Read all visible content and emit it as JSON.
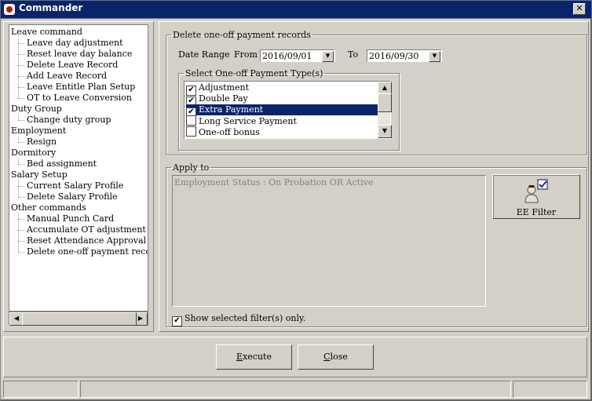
{
  "window": {
    "title": "Commander",
    "close_glyph": "✕",
    "app_icon": "commander-app-icon"
  },
  "tree": {
    "items": [
      {
        "label": "Leave command",
        "level": 0
      },
      {
        "label": "Leave day adjustment",
        "level": 1
      },
      {
        "label": "Reset leave day balance",
        "level": 1
      },
      {
        "label": "Delete Leave Record",
        "level": 1
      },
      {
        "label": "Add Leave Record",
        "level": 1
      },
      {
        "label": "Leave Entitle Plan Setup",
        "level": 1
      },
      {
        "label": "OT to Leave Conversion",
        "level": 1
      },
      {
        "label": "Duty Group",
        "level": 0
      },
      {
        "label": "Change duty group",
        "level": 1
      },
      {
        "label": "Employment",
        "level": 0
      },
      {
        "label": "Resign",
        "level": 1
      },
      {
        "label": "Dormitory",
        "level": 0
      },
      {
        "label": "Bed assignment",
        "level": 1
      },
      {
        "label": "Salary Setup",
        "level": 0
      },
      {
        "label": "Current Salary Profile",
        "level": 1
      },
      {
        "label": "Delete Salary Profile",
        "level": 1
      },
      {
        "label": "Other commands",
        "level": 0
      },
      {
        "label": "Manual Punch Card",
        "level": 1
      },
      {
        "label": "Accumulate OT adjustment",
        "level": 1
      },
      {
        "label": "Reset Attendance Approval Leve",
        "level": 1
      },
      {
        "label": "Delete one-off payment records",
        "level": 1
      }
    ],
    "scroll_left": "◀",
    "scroll_right": "▶"
  },
  "delete_group": {
    "legend": "Delete one-off payment records",
    "date_range_label": "Date Range",
    "from_label": "From",
    "from_value": "2016/09/01",
    "to_label": "To",
    "to_value": "2016/09/30",
    "type_legend": "Select One-off Payment Type(s)",
    "types": [
      {
        "label": "Adjustment",
        "checked": true,
        "selected": false
      },
      {
        "label": "Double Pay",
        "checked": true,
        "selected": false
      },
      {
        "label": "Extra Payment",
        "checked": true,
        "selected": true
      },
      {
        "label": "Long Service Payment",
        "checked": false,
        "selected": false
      },
      {
        "label": "One-off bonus",
        "checked": false,
        "selected": false
      }
    ],
    "scroll_up": "▲",
    "scroll_down": "▼"
  },
  "apply_group": {
    "legend": "Apply to",
    "filter_text": "Employment Status : On Probation OR Active",
    "ee_filter_label": "EE Filter",
    "show_selected_label": "Show selected filter(s) only.",
    "show_selected_checked": true
  },
  "footer": {
    "execute_label": "Execute",
    "execute_mnemonic": "E",
    "execute_rest": "xecute",
    "close_label": "Close",
    "close_mnemonic": "C",
    "close_rest": "lose"
  },
  "check_glyph": "✔",
  "combo_arrow": "▼"
}
